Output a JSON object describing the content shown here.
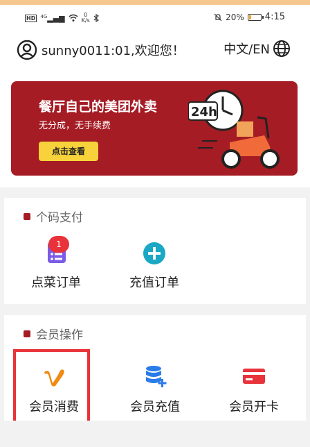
{
  "statusbar": {
    "hd": "HD",
    "network": "4G",
    "speed_value": "0",
    "speed_unit": "K/s",
    "battery": "20%",
    "battery_level": 0.2,
    "time": "4:15"
  },
  "header": {
    "greeting": "sunny0011:01,欢迎您！",
    "language": "中文/EN"
  },
  "banner": {
    "title": "餐厅自己的美团外卖",
    "subtitle": "无分成，无手续费",
    "button": "点击查看",
    "badge_text": "24h"
  },
  "sections": {
    "personal_pay": {
      "title": "个码支付",
      "items": [
        {
          "label": "点菜订单",
          "badge": "1"
        },
        {
          "label": "充值订单"
        }
      ]
    },
    "member_ops": {
      "title": "会员操作",
      "items": [
        {
          "label": "会员消费"
        },
        {
          "label": "会员充值"
        },
        {
          "label": "会员开卡"
        }
      ]
    }
  },
  "colors": {
    "brand_red": "#a51c24",
    "badge_red": "#e8333a",
    "banner_button": "#f7d23a",
    "order_icon": "#7b5ce6",
    "recharge_icon": "#1aa8c4",
    "consume_icon": "#f08a12",
    "member_recharge_icon": "#2a7ce8",
    "open_card_icon": "#e8333a"
  }
}
